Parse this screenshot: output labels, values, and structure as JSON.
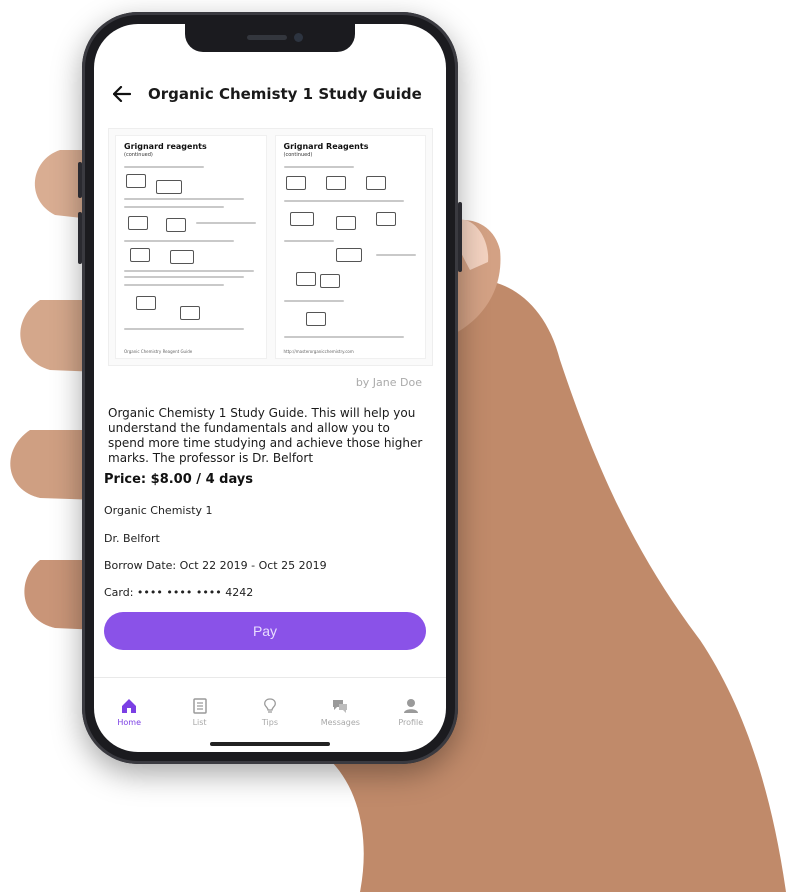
{
  "header": {
    "back_icon": "back-arrow-icon",
    "title": "Organic Chemisty 1 Study Guide"
  },
  "preview": {
    "left_page": {
      "title": "Grignard reagents",
      "subtitle": "(continued)",
      "footer": "Organic Chemistry Reagent Guide"
    },
    "right_page": {
      "title": "Grignard Reagents",
      "subtitle": "(continued)",
      "footer": "http://masterorganicchemistry.com"
    }
  },
  "author": "by Jane Doe",
  "description": "Organic Chemisty 1 Study Guide. This will help you understand the fundamentals and allow you to spend more time studying and achieve those higher marks. The professor is Dr. Belfort",
  "price": "Price: $8.00 / 4 days",
  "course": "Organic Chemisty 1",
  "professor": "Dr. Belfort",
  "borrow_date": "Borrow Date: Oct 22 2019 - Oct 25 2019",
  "card": "Card: •••• •••• •••• 4242",
  "pay_label": "Pay",
  "colors": {
    "accent": "#8a52e8",
    "active_tab": "#7b3fe4"
  },
  "tabs": [
    {
      "label": "Home",
      "icon": "home-icon",
      "active": true
    },
    {
      "label": "List",
      "icon": "list-icon",
      "active": false
    },
    {
      "label": "Tips",
      "icon": "lightbulb-icon",
      "active": false
    },
    {
      "label": "Messages",
      "icon": "messages-icon",
      "active": false
    },
    {
      "label": "Profile",
      "icon": "profile-icon",
      "active": false
    }
  ]
}
